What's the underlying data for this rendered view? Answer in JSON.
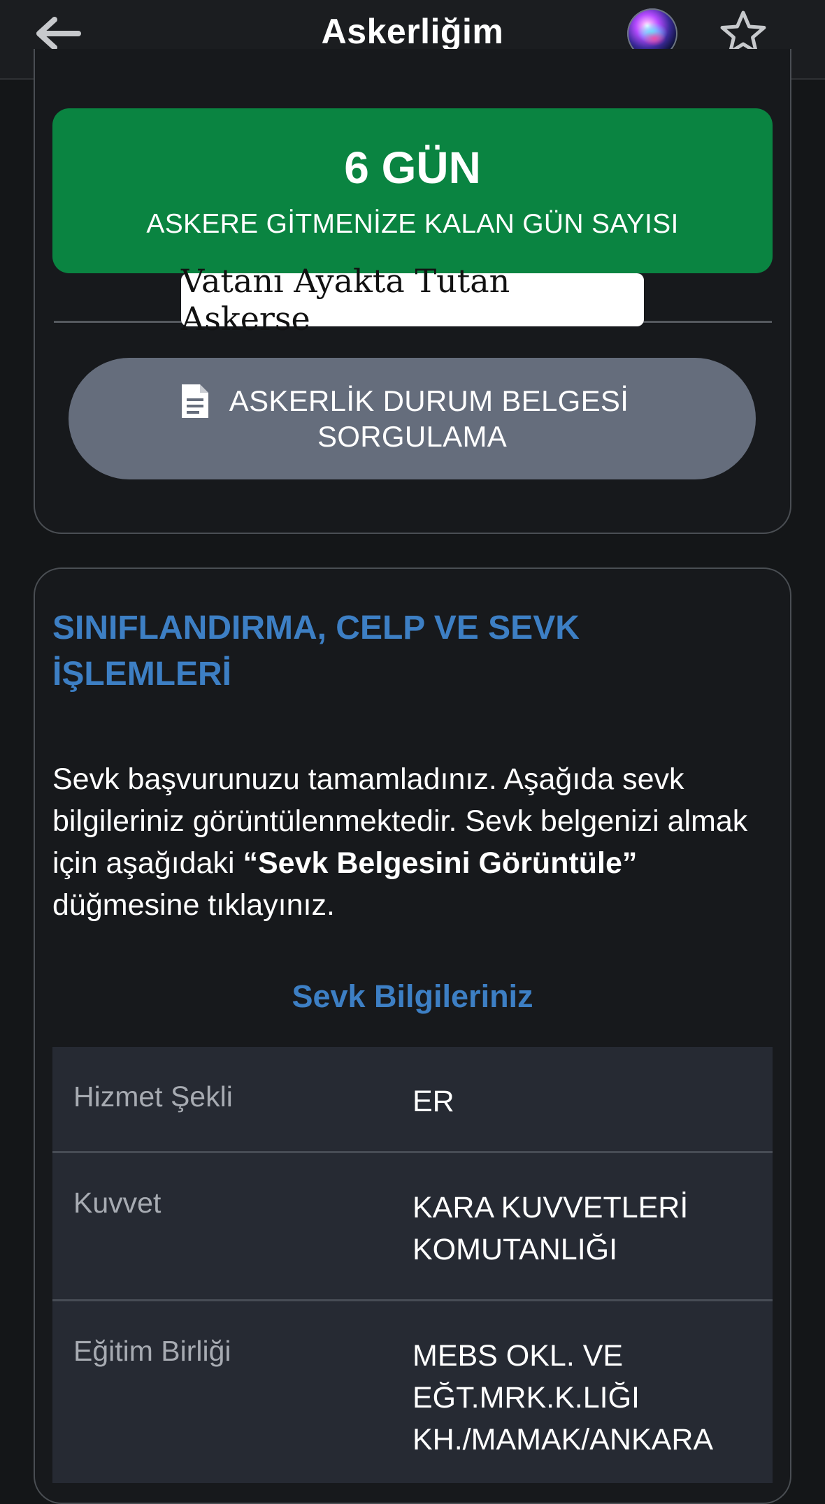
{
  "header": {
    "title": "Askerliğim",
    "back_icon": "arrow-left-icon",
    "assistant_icon": "siri-icon",
    "favorite_icon": "star-outline-icon"
  },
  "countdown": {
    "days": "6 GÜN",
    "label": "ASKERE GİTMENİZE KALAN GÜN SAYISI",
    "color": "#0a8441"
  },
  "watermark": {
    "text": "Vatanı Ayakta Tutan Askerse"
  },
  "document_button": {
    "line1": "ASKERLİK DURUM BELGESİ",
    "line2": "SORGULAMA",
    "icon": "document-icon"
  },
  "section": {
    "title_line1": "SINIFLANDIRMA, CELP VE SEVK",
    "title_line2": "İŞLEMLERİ",
    "body_part1": "Sevk başvurunuzu tamamladınız. Aşağıda sevk bilgileriniz görüntülenmektedir. Sevk belgenizi almak için aşağıdaki ",
    "body_bold": "“Sevk Belgesini Görüntüle”",
    "body_part2": " düğmesine tıklayınız.",
    "subtitle": "Sevk Bilgileriniz",
    "accent_color": "#3d7fc4"
  },
  "table": {
    "rows": [
      {
        "key": "Hizmet Şekli",
        "value_lines": [
          "ER"
        ]
      },
      {
        "key": "Kuvvet",
        "value_lines": [
          "KARA KUVVETLERİ",
          "KOMUTANLIĞI"
        ]
      },
      {
        "key": "Eğitim Birliği",
        "value_lines": [
          "MEBS OKL. VE",
          "EĞT.MRK.K.LIĞI",
          "KH./MAMAK/ANKARA"
        ]
      }
    ]
  }
}
